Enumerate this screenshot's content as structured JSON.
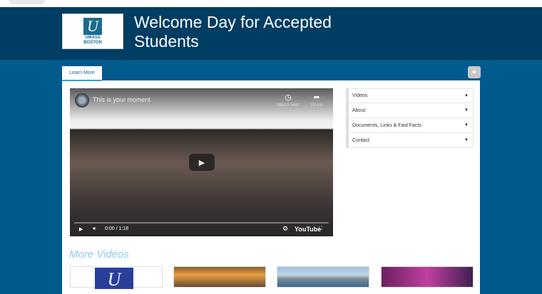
{
  "header": {
    "title": "Welcome Day for Accepted Students",
    "logo_text": "UMASS BOSTON"
  },
  "tabs": [
    {
      "label": "Learn More"
    }
  ],
  "video": {
    "title": "This is your moment",
    "watch_later": "Watch later",
    "share": "Share",
    "time": "0:00 / 1:18",
    "brand": "YouTube"
  },
  "sidebar": {
    "items": [
      {
        "label": "Videos"
      },
      {
        "label": "About"
      },
      {
        "label": "Documents, Links & Fast Facts"
      },
      {
        "label": "Contact"
      }
    ]
  },
  "more_videos": {
    "heading": "More Videos"
  }
}
